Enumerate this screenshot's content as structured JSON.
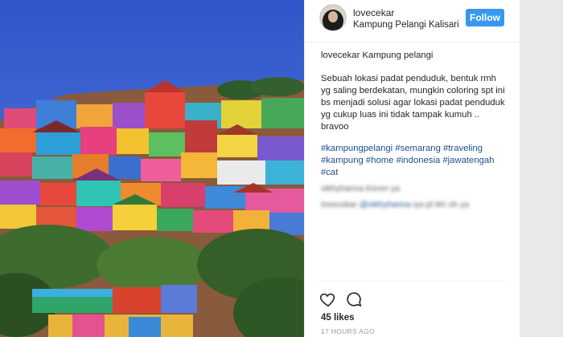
{
  "post": {
    "username": "lovecekar",
    "location": "Kampung Pelangi Kalisari",
    "follow_label": "Follow"
  },
  "caption": {
    "author": "lovecekar",
    "title": "Kampung pelangi",
    "body": "Sebuah lokasi padat penduduk, bentuk rmh yg saling berdekatan, mungkin coloring spt ini bs menjadi solusi agar lokasi padat penduduk yg cukup luas ini tidak tampak kumuh .. bravoo",
    "hashtags": [
      "#kampungpelangi",
      "#semarang",
      "#traveling",
      "#kampung",
      "#home",
      "#indonesia",
      "#jawatengah",
      "#cat"
    ]
  },
  "comments": [
    {
      "text": "sikhyhanna Keren ya"
    },
    {
      "user": "lovecekar",
      "mention": "@sikhyhanna",
      "text": "iya jd ikh oh ya"
    }
  ],
  "actions": {
    "like_icon": "heart-icon",
    "comment_icon": "comment-icon"
  },
  "stats": {
    "likes": "45 likes",
    "time": "17 HOURS AGO"
  },
  "colors": {
    "follow_bg": "#3897f0",
    "hashtag": "#1a4d8f"
  }
}
